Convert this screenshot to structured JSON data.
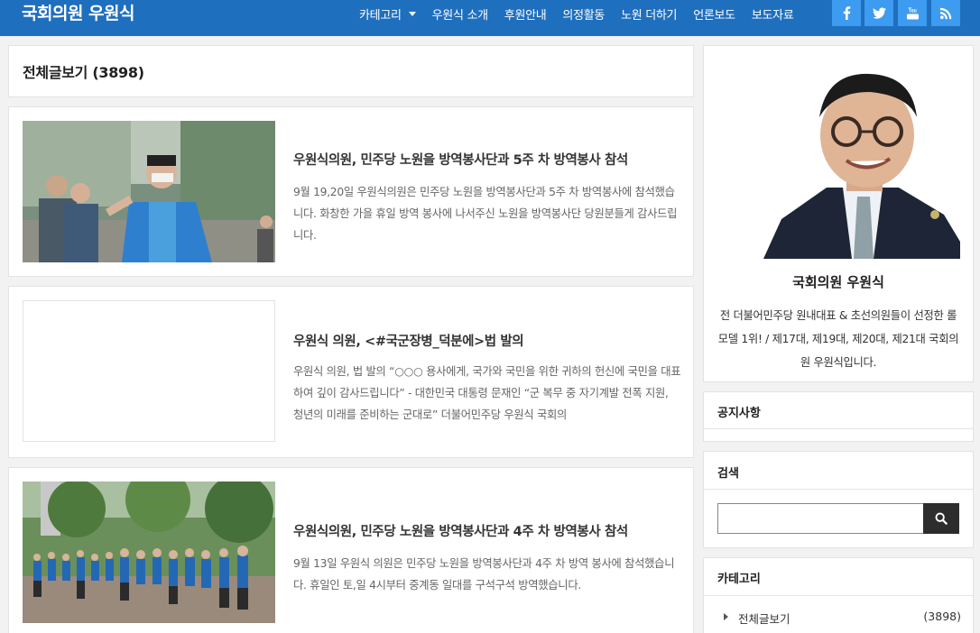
{
  "header": {
    "site_title": "국회의원 우원식",
    "nav": [
      {
        "label": "카테고리",
        "has_dropdown": true
      },
      {
        "label": "우원식 소개"
      },
      {
        "label": "후원안내"
      },
      {
        "label": "의정활동"
      },
      {
        "label": "노원 더하기"
      },
      {
        "label": "언론보도"
      },
      {
        "label": "보도자료"
      }
    ],
    "social": [
      "facebook-icon",
      "twitter-icon",
      "youtube-icon",
      "rss-icon"
    ],
    "bg_color": "#1f6fbf",
    "social_color": "#3d9bf0"
  },
  "main": {
    "heading": "전체글보기 (3898)",
    "posts": [
      {
        "title": "우원식의원, 민주당 노원을 방역봉사단과 5주 차 방역봉사 참석",
        "excerpt": "9월 19,20일 우원식의원은 민주당 노원을 방역봉사단과 5주 차 방역봉사에 참석했습니다. 화창한 가을 휴일 방역 봉사에 나서주신 노원을 방역봉사단 당원분들게 감사드립니다.",
        "thumbnail": "photo-volunteer-walking"
      },
      {
        "title": "우원식 의원, <#국군장병_덕분에>법 발의",
        "excerpt": "우원식 의원, 법 발의 “○○○ 용사에게, 국가와 국민을 위한 귀하의 헌신에 국민을 대표하여 깊이 감사드립니다” - 대한민국 대통령 문재인 “군 복무 중 자기계발 전폭 지원, 청년의 미래를 준비하는 군대로” 더불어민주당 우원식 국회의",
        "thumbnail": "empty"
      },
      {
        "title": "우원식의원, 민주당 노원을 방역봉사단과 4주 차 방역봉사 참석",
        "excerpt": "9월 13일 우원식 의원은 민주당 노원을 방역봉사단과 4주 차 방역 봉사에 참석했습니다. 휴일인 토,일 4시부터 중계동 일대를 구석구석 방역했습니다.",
        "thumbnail": "photo-volunteer-group"
      }
    ]
  },
  "sidebar": {
    "profile": {
      "name": "국회의원 우원식",
      "description": "전 더불어민주당 원내대표 & 초선의원들이 선정한 롤모델 1위! / 제17대, 제19대, 제20대, 제21대 국회의원 우원식입니다."
    },
    "notice_title": "공지사항",
    "search_title": "검색",
    "search_value": "",
    "category_title": "카테고리",
    "categories": [
      {
        "label": "전체글보기",
        "count": "(3898)"
      }
    ]
  }
}
